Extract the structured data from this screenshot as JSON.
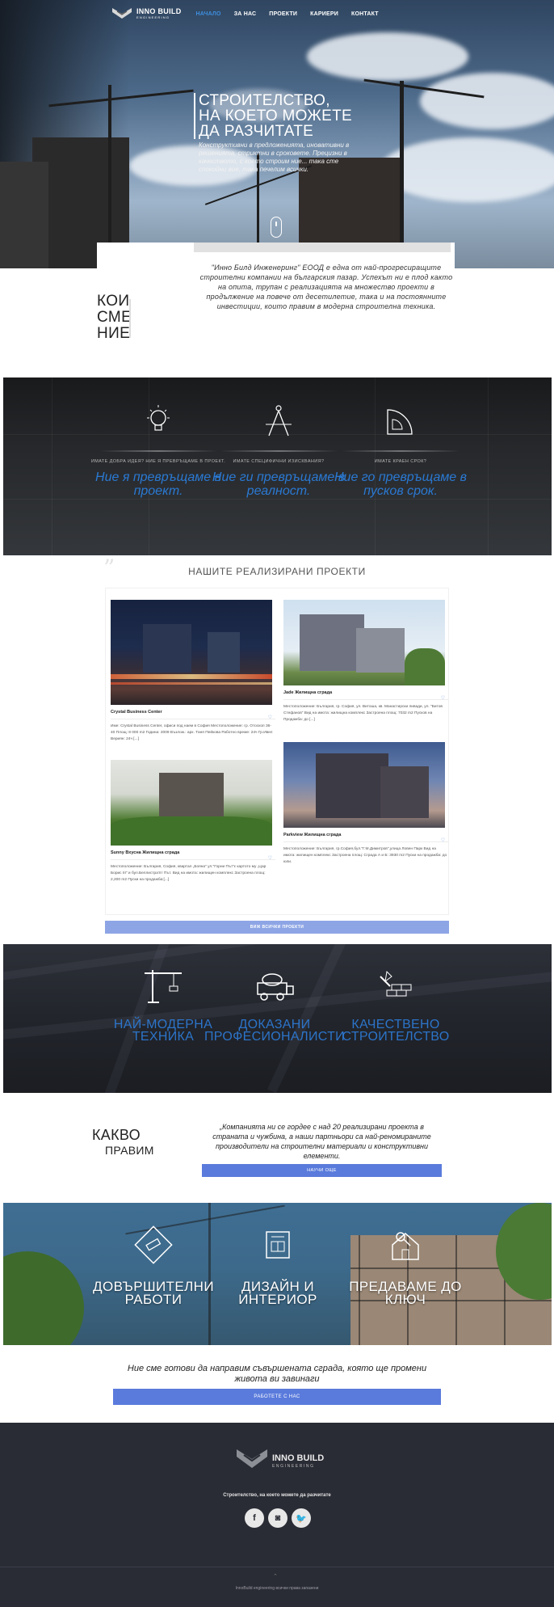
{
  "nav": {
    "logo": {
      "line1": "INNO BUILD",
      "line2": "ENGINEERING"
    },
    "items": [
      {
        "label": "НАЧАЛО",
        "active": true
      },
      {
        "label": "ЗА НАС",
        "active": false
      },
      {
        "label": "ПРОЕКТИ",
        "active": false
      },
      {
        "label": "КАРИЕРИ",
        "active": false
      },
      {
        "label": "КОНТАКТ",
        "active": false
      }
    ]
  },
  "hero": {
    "title_line1": "СТРОИТЕЛСТВО,",
    "title_line2": "НА КОЕТО МОЖЕТЕ",
    "title_line3": "ДА РАЗЧИТАТЕ",
    "subtitle": "Конструктивни в предложенията, иновативни в решенията, стриктни в сроковете. Прецизни в качеството, с което строим ние... така сте спокойни вие, така печелим всички."
  },
  "about": {
    "title_line1": "КОИ",
    "title_line2": "СМЕ",
    "title_line3": "НИЕ",
    "text": "\"Инно Билд Инженеринг\" ЕООД е една от най-прогресиращите строителни компании на българския пазар. Успехът ни е плод както на опита, трупан с реализацията на множество проекти в продължение на повече от десетилетие, така и на постоянните инвестиции, които правим в модерна строителна техника."
  },
  "features": [
    {
      "icon": "lightbulb-icon",
      "small": "ИМАТЕ ДОБРА ИДЕЯ? НИЕ Я ПРЕВРЪЩАМЕ В ПРОЕКТ.",
      "big": "Ние я превръщаме в проект."
    },
    {
      "icon": "compass-icon",
      "small": "ИМАТЕ СПЕЦИФИЧНИ ИЗИСКВАНИЯ?",
      "big": "Ние ги превръщаме в реалност."
    },
    {
      "icon": "protractor-icon",
      "small": "ИМАТЕ КРАЕН СРОК?",
      "big": "Ние го превръщаме в пусков срок."
    }
  ],
  "projects": {
    "heading": "НАШИТЕ РЕАЛИЗИРАНИ ПРОЕКТИ",
    "items": [
      {
        "name": "Crystal Business Center",
        "desc": "Име: Crystal Business Center, офиси под наем в София Местоположение: гр. Отоскоп 36-40 Площ: 8 000 m2 Година: 2009 Възлож.: арх. Таня Пейкова Работно време: 24ч Гр.Ивел Вериян: 24ч [...]"
      },
      {
        "name": "Jade Жилищна сграда",
        "desc": "Местоположение: България, гр. София, ул. Витоша, кв. Манастирски ливади, ул. \"Битов Стефанов\" Вид на имота: жилищна комплекс Застроена площ: 7032 m2 Пусков на Продажба: до [...]"
      },
      {
        "name": "Sunny Вхусна Жилищна сграда",
        "desc": "Местоположение: България, София, квартал „Бояна\" ул.\"Горни Път\"ε картото му „Цар Борис III\" и бул.Беллистра'пт Път. Вид на имота: жилищен комплекс Застроена площ: 2,200 m2 Пуски на продажба:[...]"
      },
      {
        "name": "Parkview Жилищна сграда",
        "desc": "Местоположение: България, гр.София,бул.\"Г.М.Димитров\",улица Ловен Парк Вид на имота: жилищен комплекс Застроена площ: Сграда А и Б: 3930 m2 Пуски на продажба: до юли."
      }
    ],
    "button": "ВИЖ ВСИЧКИ ПРОЕКТИ"
  },
  "strengths": [
    {
      "icon": "crane-icon",
      "line1": "НАЙ-МОДЕРНА",
      "line2": "ТЕХНИКА"
    },
    {
      "icon": "concrete-mixer-icon",
      "line1": "ДОКАЗАНИ",
      "line2": "ПРОФЕСИОНАЛИСТИ"
    },
    {
      "icon": "brick-trowel-icon",
      "line1": "КАЧЕСТВЕНО",
      "line2": "СТРОИТЕЛСТВО"
    }
  ],
  "what_we_do": {
    "title": "КАКВО",
    "title_sub": "ПРАВИМ",
    "text": "„Компанията ни се гордее с над 20 реализирани проекта в страната и чужбина, а наши партньори са най-реномираните производители на строителни материали и конструктивни елементи.",
    "button": "НАУЧИ ОЩЕ"
  },
  "services": [
    {
      "icon": "paint-roller-icon",
      "line1": "ДОВЪРШИТЕЛНИ",
      "line2": "РАБОТИ"
    },
    {
      "icon": "blueprint-icon",
      "line1": "ДИЗАЙН И",
      "line2": "ИНТЕРИОР"
    },
    {
      "icon": "house-key-icon",
      "line1": "ПРЕДАВАМЕ ДО",
      "line2": "КЛЮЧ"
    }
  ],
  "cta": {
    "text": "Ние сме готови да направим съвършената сграда, която ще промени живота ви завинаги",
    "button": "РАБОТЕТЕ С НАС"
  },
  "footer": {
    "logo_line1": "INNO BUILD",
    "logo_line2": "ENGINEERING",
    "tagline": "Строителство, на което можете да разчитате",
    "social": [
      {
        "icon": "facebook-icon",
        "glyph": "f"
      },
      {
        "icon": "instagram-icon",
        "glyph": "◙"
      },
      {
        "icon": "twitter-icon",
        "glyph": "🐦"
      }
    ],
    "copyright": "InnoBuild engineering всички права запазени"
  },
  "colors": {
    "accent": "#2a79d3",
    "button": "#5a7bdc",
    "footer": "#2a2c35"
  }
}
